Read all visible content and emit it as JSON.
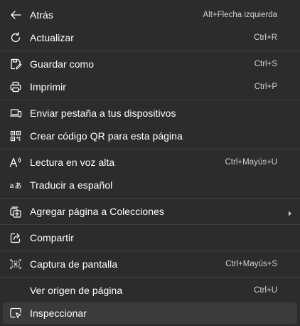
{
  "menu": {
    "items": [
      {
        "label": "Atrás",
        "shortcut": "Alt+Flecha izquierda",
        "icon": "back-arrow-icon"
      },
      {
        "label": "Actualizar",
        "shortcut": "Ctrl+R",
        "icon": "refresh-icon"
      },
      {
        "label": "Guardar como",
        "shortcut": "Ctrl+S",
        "icon": "save-as-icon"
      },
      {
        "label": "Imprimir",
        "shortcut": "Ctrl+P",
        "icon": "printer-icon"
      },
      {
        "label": "Enviar pestaña a tus dispositivos",
        "shortcut": "",
        "icon": "send-to-devices-icon"
      },
      {
        "label": "Crear código QR para esta página",
        "shortcut": "",
        "icon": "qr-code-icon"
      },
      {
        "label": "Lectura en voz alta",
        "shortcut": "Ctrl+Mayús+U",
        "icon": "read-aloud-icon"
      },
      {
        "label": "Traducir a español",
        "shortcut": "",
        "icon": "translate-icon"
      },
      {
        "label": "Agregar página a Colecciones",
        "shortcut": "",
        "icon": "collections-icon",
        "submenu": true
      },
      {
        "label": "Compartir",
        "shortcut": "",
        "icon": "share-icon"
      },
      {
        "label": "Captura de pantalla",
        "shortcut": "Ctrl+Mayús+S",
        "icon": "screenshot-icon"
      },
      {
        "label": "Ver origen de página",
        "shortcut": "Ctrl+U",
        "icon": ""
      },
      {
        "label": "Inspeccionar",
        "shortcut": "",
        "icon": "inspect-icon",
        "hover": true
      }
    ]
  },
  "colors": {
    "background": "#2c2c2c",
    "hover": "#3a3a3a",
    "separator": "#3f3f3f",
    "text": "#ffffff",
    "shortcut_text": "#d0d0d0"
  }
}
